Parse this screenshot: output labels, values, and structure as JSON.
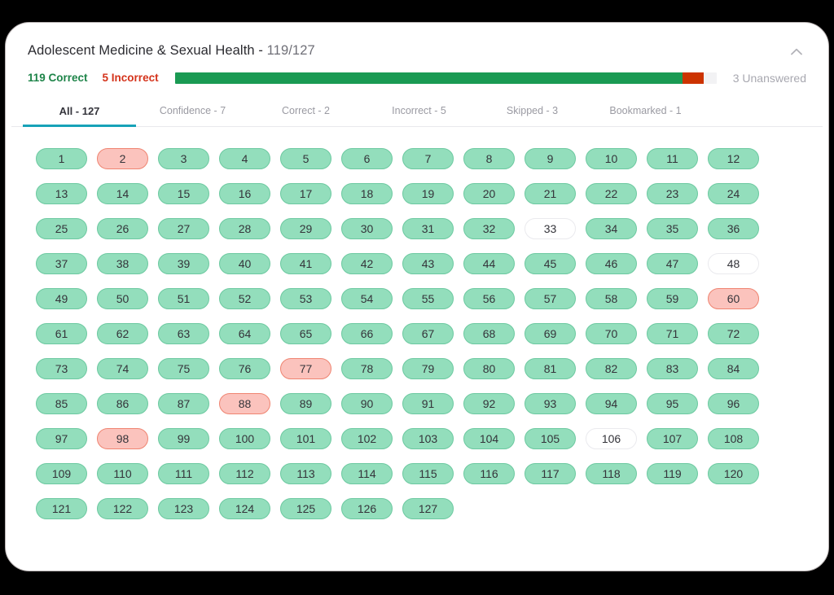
{
  "header": {
    "title_main": "Adolescent Medicine & Sexual Health - ",
    "title_score": "119/127",
    "collapse_icon": "chevron-up-icon"
  },
  "summary": {
    "correct_label": "119 Correct",
    "incorrect_label": "5 Incorrect",
    "unanswered_label": "3 Unanswered",
    "correct_count": 119,
    "incorrect_count": 5,
    "unanswered_count": 3,
    "total": 127,
    "colors": {
      "correct": "#1a9a53",
      "incorrect": "#cc3300",
      "unanswered": "#f2f2f4",
      "correct_text": "#1e8449",
      "incorrect_text": "#d4331b",
      "unanswered_text": "#a8a8b0",
      "tab_accent": "#17a2b8",
      "pill_correct_bg": "#93debc",
      "pill_correct_border": "#6cc9a0",
      "pill_incorrect_bg": "#fbc3bd",
      "pill_incorrect_border": "#ef8471",
      "pill_unanswered_bg": "#ffffff",
      "pill_unanswered_border": "#eaeaee"
    }
  },
  "tabs": [
    {
      "label": "All - 127",
      "active": true
    },
    {
      "label": "Confidence - 7",
      "active": false
    },
    {
      "label": "Correct - 2",
      "active": false
    },
    {
      "label": "Incorrect - 5",
      "active": false
    },
    {
      "label": "Skipped - 3",
      "active": false
    },
    {
      "label": "Bookmarked - 1",
      "active": false
    }
  ],
  "questions": [
    {
      "n": "1",
      "state": "correct"
    },
    {
      "n": "2",
      "state": "incorrect"
    },
    {
      "n": "3",
      "state": "correct"
    },
    {
      "n": "4",
      "state": "correct"
    },
    {
      "n": "5",
      "state": "correct"
    },
    {
      "n": "6",
      "state": "correct"
    },
    {
      "n": "7",
      "state": "correct"
    },
    {
      "n": "8",
      "state": "correct"
    },
    {
      "n": "9",
      "state": "correct"
    },
    {
      "n": "10",
      "state": "correct"
    },
    {
      "n": "11",
      "state": "correct"
    },
    {
      "n": "12",
      "state": "correct"
    },
    {
      "n": "13",
      "state": "correct"
    },
    {
      "n": "14",
      "state": "correct"
    },
    {
      "n": "15",
      "state": "correct"
    },
    {
      "n": "16",
      "state": "correct"
    },
    {
      "n": "17",
      "state": "correct"
    },
    {
      "n": "18",
      "state": "correct"
    },
    {
      "n": "19",
      "state": "correct"
    },
    {
      "n": "20",
      "state": "correct"
    },
    {
      "n": "21",
      "state": "correct"
    },
    {
      "n": "22",
      "state": "correct"
    },
    {
      "n": "23",
      "state": "correct"
    },
    {
      "n": "24",
      "state": "correct"
    },
    {
      "n": "25",
      "state": "correct"
    },
    {
      "n": "26",
      "state": "correct"
    },
    {
      "n": "27",
      "state": "correct"
    },
    {
      "n": "28",
      "state": "correct"
    },
    {
      "n": "29",
      "state": "correct"
    },
    {
      "n": "30",
      "state": "correct"
    },
    {
      "n": "31",
      "state": "correct"
    },
    {
      "n": "32",
      "state": "correct"
    },
    {
      "n": "33",
      "state": "unanswered"
    },
    {
      "n": "34",
      "state": "correct"
    },
    {
      "n": "35",
      "state": "correct"
    },
    {
      "n": "36",
      "state": "correct"
    },
    {
      "n": "37",
      "state": "correct"
    },
    {
      "n": "38",
      "state": "correct"
    },
    {
      "n": "39",
      "state": "correct"
    },
    {
      "n": "40",
      "state": "correct"
    },
    {
      "n": "41",
      "state": "correct"
    },
    {
      "n": "42",
      "state": "correct"
    },
    {
      "n": "43",
      "state": "correct"
    },
    {
      "n": "44",
      "state": "correct"
    },
    {
      "n": "45",
      "state": "correct"
    },
    {
      "n": "46",
      "state": "correct"
    },
    {
      "n": "47",
      "state": "correct"
    },
    {
      "n": "48",
      "state": "unanswered"
    },
    {
      "n": "49",
      "state": "correct"
    },
    {
      "n": "50",
      "state": "correct"
    },
    {
      "n": "51",
      "state": "correct"
    },
    {
      "n": "52",
      "state": "correct"
    },
    {
      "n": "53",
      "state": "correct"
    },
    {
      "n": "54",
      "state": "correct"
    },
    {
      "n": "55",
      "state": "correct"
    },
    {
      "n": "56",
      "state": "correct"
    },
    {
      "n": "57",
      "state": "correct"
    },
    {
      "n": "58",
      "state": "correct"
    },
    {
      "n": "59",
      "state": "correct"
    },
    {
      "n": "60",
      "state": "incorrect"
    },
    {
      "n": "61",
      "state": "correct"
    },
    {
      "n": "62",
      "state": "correct"
    },
    {
      "n": "63",
      "state": "correct"
    },
    {
      "n": "64",
      "state": "correct"
    },
    {
      "n": "65",
      "state": "correct"
    },
    {
      "n": "66",
      "state": "correct"
    },
    {
      "n": "67",
      "state": "correct"
    },
    {
      "n": "68",
      "state": "correct"
    },
    {
      "n": "69",
      "state": "correct"
    },
    {
      "n": "70",
      "state": "correct"
    },
    {
      "n": "71",
      "state": "correct"
    },
    {
      "n": "72",
      "state": "correct"
    },
    {
      "n": "73",
      "state": "correct"
    },
    {
      "n": "74",
      "state": "correct"
    },
    {
      "n": "75",
      "state": "correct"
    },
    {
      "n": "76",
      "state": "correct"
    },
    {
      "n": "77",
      "state": "incorrect"
    },
    {
      "n": "78",
      "state": "correct"
    },
    {
      "n": "79",
      "state": "correct"
    },
    {
      "n": "80",
      "state": "correct"
    },
    {
      "n": "81",
      "state": "correct"
    },
    {
      "n": "82",
      "state": "correct"
    },
    {
      "n": "83",
      "state": "correct"
    },
    {
      "n": "84",
      "state": "correct"
    },
    {
      "n": "85",
      "state": "correct"
    },
    {
      "n": "86",
      "state": "correct"
    },
    {
      "n": "87",
      "state": "correct"
    },
    {
      "n": "88",
      "state": "incorrect"
    },
    {
      "n": "89",
      "state": "correct"
    },
    {
      "n": "90",
      "state": "correct"
    },
    {
      "n": "91",
      "state": "correct"
    },
    {
      "n": "92",
      "state": "correct"
    },
    {
      "n": "93",
      "state": "correct"
    },
    {
      "n": "94",
      "state": "correct"
    },
    {
      "n": "95",
      "state": "correct"
    },
    {
      "n": "96",
      "state": "correct"
    },
    {
      "n": "97",
      "state": "correct"
    },
    {
      "n": "98",
      "state": "incorrect"
    },
    {
      "n": "99",
      "state": "correct"
    },
    {
      "n": "100",
      "state": "correct"
    },
    {
      "n": "101",
      "state": "correct"
    },
    {
      "n": "102",
      "state": "correct"
    },
    {
      "n": "103",
      "state": "correct"
    },
    {
      "n": "104",
      "state": "correct"
    },
    {
      "n": "105",
      "state": "correct"
    },
    {
      "n": "106",
      "state": "unanswered"
    },
    {
      "n": "107",
      "state": "correct"
    },
    {
      "n": "108",
      "state": "correct"
    },
    {
      "n": "109",
      "state": "correct"
    },
    {
      "n": "110",
      "state": "correct"
    },
    {
      "n": "111",
      "state": "correct"
    },
    {
      "n": "112",
      "state": "correct"
    },
    {
      "n": "113",
      "state": "correct"
    },
    {
      "n": "114",
      "state": "correct"
    },
    {
      "n": "115",
      "state": "correct"
    },
    {
      "n": "116",
      "state": "correct"
    },
    {
      "n": "117",
      "state": "correct"
    },
    {
      "n": "118",
      "state": "correct"
    },
    {
      "n": "119",
      "state": "correct"
    },
    {
      "n": "120",
      "state": "correct"
    },
    {
      "n": "121",
      "state": "correct"
    },
    {
      "n": "122",
      "state": "correct"
    },
    {
      "n": "123",
      "state": "correct"
    },
    {
      "n": "124",
      "state": "correct"
    },
    {
      "n": "125",
      "state": "correct"
    },
    {
      "n": "126",
      "state": "correct"
    },
    {
      "n": "127",
      "state": "correct"
    }
  ]
}
